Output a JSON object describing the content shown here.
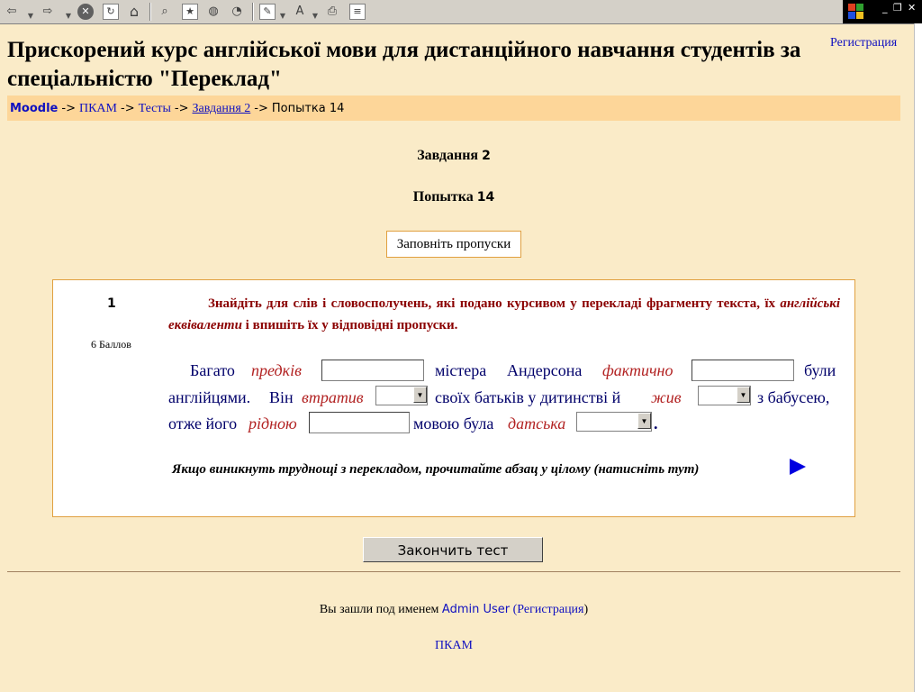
{
  "toolbar": {
    "icons": [
      "back-icon",
      "forward-icon",
      "stop-icon",
      "refresh-icon",
      "home-icon",
      "search-icon",
      "favorites-icon",
      "history-icon",
      "media-icon",
      "edit-icon",
      "font-icon",
      "print-icon",
      "discuss-icon"
    ],
    "window_controls": {
      "minimize": "_",
      "restore": "❐",
      "close": "✕"
    }
  },
  "header": {
    "title": "Прискорений курс англійської мови для дистанційного навчання студентів за спеціальністю \"Переклад\"",
    "login_link": "Регистрация"
  },
  "breadcrumb": {
    "items": [
      "Moodle",
      "ПКАМ",
      "Тесты",
      "Завдання 2"
    ],
    "current": "Попытка 14",
    "separator": "->"
  },
  "quiz": {
    "name_label": "Завдання",
    "name_num": "2",
    "attempt_label": "Попытка",
    "attempt_num": "14",
    "description": "Заповніть пропуски"
  },
  "question": {
    "number": "1",
    "points": "6 Баллов",
    "instruction_part1": "Знайдіть для слів і словосполучень, які подано курсивом у  перекладі фрагменту текста, їх ",
    "instruction_italic": "англійські еквіваленти",
    "instruction_part2": " і впишіть їх у відповідні пропуски.",
    "line1": {
      "w1": "Багато",
      "it1": "предків",
      "w2": "містера",
      "w3": "Андерсона",
      "it2": "фактично",
      "w4": "були"
    },
    "line2": {
      "w1": "англійцями.",
      "w2": "Він",
      "it1": "втратив",
      "w3": "своїх батьків у дитинстві й",
      "it2": "жив",
      "w4": "з бабусею,"
    },
    "line3": {
      "w1": "отже його",
      "it1": "рідною",
      "w2": "мовою була",
      "it2": "датська",
      "w3": "."
    },
    "hint": "Якщо виникнуть труднощі з перекладом, прочитайте абзац у цілому (натисніть тут)"
  },
  "finish_button": "Закончить тест",
  "footer": {
    "logged_in_as": "Вы зашли под именем",
    "user": "Admin User",
    "logout_paren_open": "(",
    "logout": "Регистрация",
    "logout_paren_close": ")",
    "course_link": "ПКАМ"
  },
  "colors": {
    "page_bg": "#faebc8",
    "navbar_bg": "#fdd699",
    "link": "#1010c0",
    "italic_red": "#b22222",
    "text_blue": "#00006a"
  }
}
